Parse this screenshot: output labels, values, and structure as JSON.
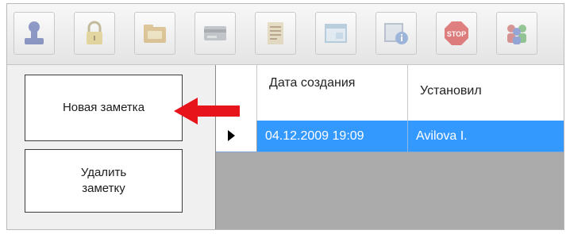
{
  "toolbar": {
    "buttons": [
      {
        "icon": "user-stamp-icon"
      },
      {
        "icon": "lock-icon"
      },
      {
        "icon": "folder-icon"
      },
      {
        "icon": "card-icon"
      },
      {
        "icon": "notes-icon"
      },
      {
        "icon": "window-icon"
      },
      {
        "icon": "info-icon"
      },
      {
        "icon": "stop-sign-icon",
        "label": "STOP"
      },
      {
        "icon": "users-icon"
      }
    ]
  },
  "actions": {
    "new_note": "Новая заметка",
    "delete_note": "Удалить заметку"
  },
  "grid": {
    "columns": [
      "Дата создания",
      "Установил"
    ],
    "rows": [
      {
        "date": "04.12.2009 19:09",
        "set_by": "Avilova I.",
        "selected": true
      }
    ]
  },
  "colors": {
    "selection": "#3399ff",
    "arrow": "#e8141b"
  }
}
